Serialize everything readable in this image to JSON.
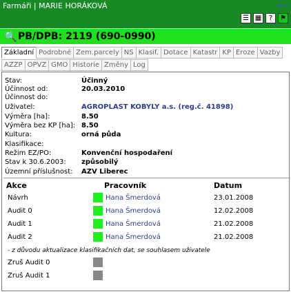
{
  "topbar": {
    "title": "Farmáři | MARIE HORÁKOVÁ"
  },
  "header": {
    "title": "PB/DPB: 2119 (690-0990)"
  },
  "tabs": {
    "row1": [
      "Základní",
      "Podrobné",
      "Zem.parcely",
      "NS",
      "Klasif.",
      "Dotace",
      "Katastr",
      "KP",
      "Eroze",
      "Vazby"
    ],
    "row2": [
      "AZZP",
      "OPVZ",
      "GMO",
      "Historie",
      "Změny",
      "Log"
    ]
  },
  "fields": [
    {
      "label": "Stav:",
      "value": "Účinný"
    },
    {
      "label": "Účinnost od:",
      "value": "20.03.2010"
    },
    {
      "label": "Účinnost do:",
      "value": ""
    },
    {
      "label": "Uživatel:",
      "value": "AGROPLAST KOBYLY a.s. (reg.č. 41898)"
    },
    {
      "label": "Výměra [ha]:",
      "value": "8.50"
    },
    {
      "label": "Výměra bez KP [ha]:",
      "value": "8.50"
    },
    {
      "label": "Kultura:",
      "value": "orná půda"
    },
    {
      "label": "Klasifikace:",
      "value": ""
    },
    {
      "label": "Režim EZ/PO:",
      "value": "Konvenční hospodaření"
    },
    {
      "label": "Stav k 30.6.2003:",
      "value": "způsobilý"
    },
    {
      "label": "Územní příslušnost:",
      "value": "AZV Liberec"
    }
  ],
  "actions_table": {
    "headers": [
      "Akce",
      "Pracovník",
      "Datum"
    ],
    "rows": [
      {
        "action": "Návrh",
        "worker": "Hana Šmerdová",
        "date": "23.01.2008",
        "status_color": "#22ee22"
      },
      {
        "action": "Audit 0",
        "worker": "Hana Šmerdová",
        "date": "12.02.2008",
        "status_color": "#22ee22"
      },
      {
        "action": "Audit 1",
        "worker": "Hana Šmerdová",
        "date": "21.02.2008",
        "status_color": "#22ee22"
      },
      {
        "action": "Audit 2",
        "worker": "Hana Šmerdová",
        "date": "21.02.2008",
        "status_color": "#22ee22"
      }
    ],
    "note": "- z důvodu aktualizace klasifikačních dat, se souhlasem uživatele",
    "cancel_rows": [
      {
        "action": "Zruš Audit 0",
        "status_color": "#888888"
      },
      {
        "action": "Zruš Audit 1",
        "status_color": "#888888"
      }
    ]
  },
  "icons": {
    "back": "back-arrow-icon",
    "print": "print-icon",
    "table": "table-icon",
    "help": "help-icon",
    "map": "map-pin-icon",
    "search": "search-icon"
  }
}
